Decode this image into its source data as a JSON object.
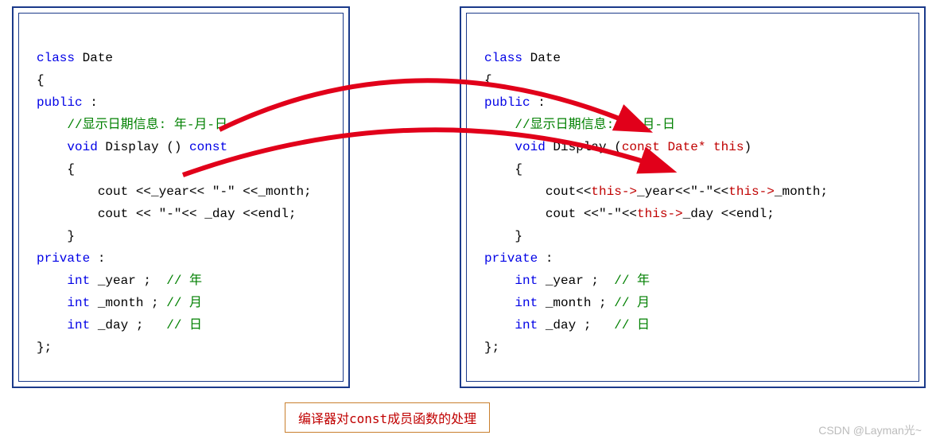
{
  "left": {
    "l1a": "class",
    "l1b": " Date",
    "l2": "{",
    "l3a": "public",
    "l3b": " :",
    "l4": "//显示日期信息: 年-月-日",
    "l5a": "void",
    "l5b": " Display () ",
    "l5c": "const",
    "l6": "{",
    "l7": "cout <<_year<< \"-\" <<_month;",
    "l8": "cout << \"-\"<< _day <<endl;",
    "l9": "}",
    "l10a": "private",
    "l10b": " :",
    "l11a": "int",
    "l11b": " _year ;  ",
    "l11c": "// 年",
    "l12a": "int",
    "l12b": " _month ; ",
    "l12c": "// 月",
    "l13a": "int",
    "l13b": " _day ;   ",
    "l13c": "// 日",
    "l14": "};"
  },
  "right": {
    "l1a": "class",
    "l1b": " Date",
    "l2": "{",
    "l3a": "public",
    "l3b": " :",
    "l4": "//显示日期信息: 年-月-日",
    "l5a": "void",
    "l5b": " Display (",
    "l5c": "const Date* this",
    "l5d": ")",
    "l6": "{",
    "l7a": "cout<<",
    "l7b": "this->",
    "l7c": "_year<<\"-\"<<",
    "l7d": "this->",
    "l7e": "_month;",
    "l8a": "cout <<\"-\"<<",
    "l8b": "this->",
    "l8c": "_day <<endl;",
    "l9": "}",
    "l10a": "private",
    "l10b": " :",
    "l11a": "int",
    "l11b": " _year ;  ",
    "l11c": "// 年",
    "l12a": "int",
    "l12b": " _month ; ",
    "l12c": "// 月",
    "l13a": "int",
    "l13b": " _day ;   ",
    "l13c": "// 日",
    "l14": "};"
  },
  "caption": "编译器对const成员函数的处理",
  "watermark": "CSDN @Layman光~"
}
